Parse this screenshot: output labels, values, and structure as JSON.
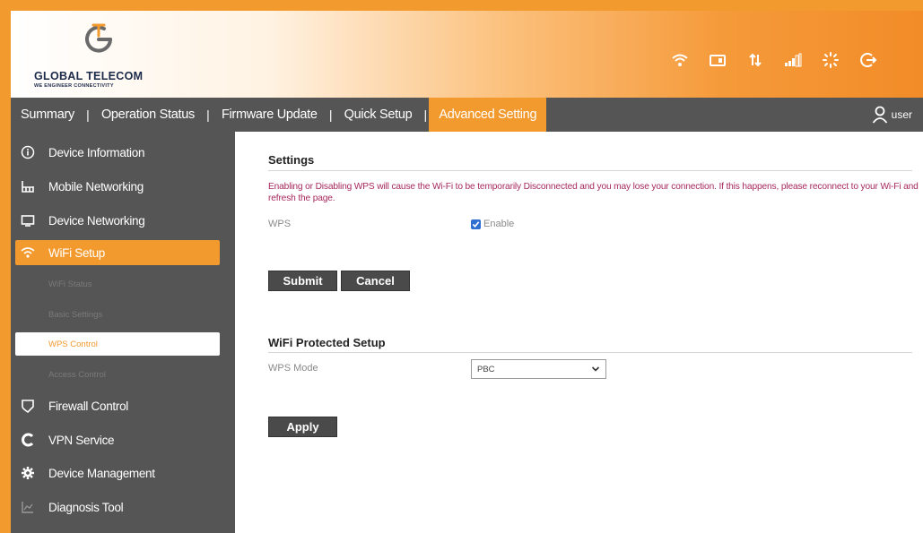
{
  "brand": {
    "name": "GLOBAL TELECOM",
    "tagline": "WE ENGINEER CONNECTIVITY",
    "accent_color": "#f39a2e",
    "logo_navy": "#1c2a4a"
  },
  "status_icons": [
    "wifi-icon",
    "sim-card-icon",
    "data-transfer-icon",
    "signal-strength-icon",
    "loading-icon",
    "logout-icon"
  ],
  "nav": {
    "items": [
      {
        "label": "Summary"
      },
      {
        "label": "Operation Status"
      },
      {
        "label": "Firmware Update"
      },
      {
        "label": "Quick Setup"
      },
      {
        "label": "Advanced Setting",
        "active": true
      }
    ],
    "separator": "|",
    "user_label": "user"
  },
  "sidebar": {
    "items": [
      {
        "label": "Device Information",
        "icon": "info-icon"
      },
      {
        "label": "Mobile Networking",
        "icon": "network-icon"
      },
      {
        "label": "Device Networking",
        "icon": "monitor-icon"
      },
      {
        "label": "WiFi Setup",
        "icon": "wifi-icon",
        "active": true
      },
      {
        "label": "Firewall Control",
        "icon": "shield-icon"
      },
      {
        "label": "VPN Service",
        "icon": "vpn-icon"
      },
      {
        "label": "Device Management",
        "icon": "gear-icon"
      },
      {
        "label": "Diagnosis Tool",
        "icon": "chart-icon"
      }
    ],
    "wifi_subitems": [
      {
        "label": "WiFi Status"
      },
      {
        "label": "Basic Settings"
      },
      {
        "label": "WPS Control",
        "selected": true
      },
      {
        "label": "Access Control"
      }
    ]
  },
  "settings": {
    "title": "Settings",
    "warning": "Enabling or Disabling WPS will cause the Wi-Fi to be temporarily Disconnected and you may lose your connection. If this happens, please reconnect to your Wi-Fi and refresh the page.",
    "wps_label": "WPS",
    "wps_enable_label": "Enable",
    "wps_enabled": true,
    "submit_label": "Submit",
    "cancel_label": "Cancel"
  },
  "wps_setup": {
    "title": "WiFi Protected Setup",
    "mode_label": "WPS Mode",
    "mode_value": "PBC",
    "apply_label": "Apply"
  }
}
